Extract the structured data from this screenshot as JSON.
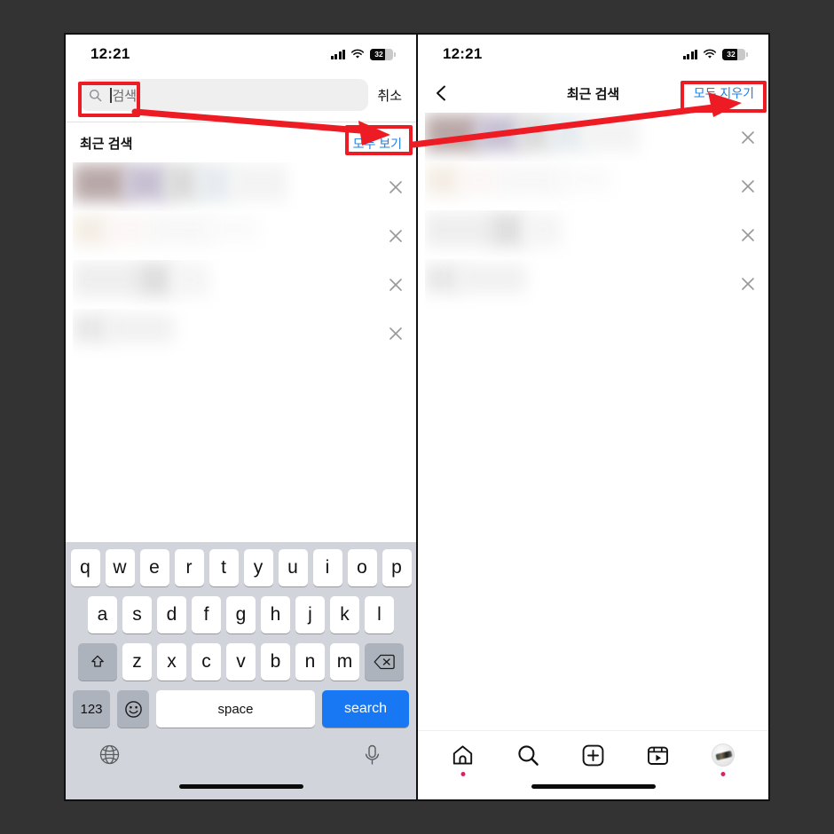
{
  "background_color": "#333333",
  "accent_color": "#1f7fe0",
  "annotation_color": "#ed1c24",
  "left_phone": {
    "status_bar": {
      "time": "12:21",
      "signal_icon": "cellular-signal-icon",
      "wifi_icon": "wifi-icon",
      "battery_icon": "battery-icon",
      "battery_percent": "32"
    },
    "search": {
      "icon": "search-icon",
      "value": "",
      "placeholder": "검색",
      "cancel_label": "취소"
    },
    "section": {
      "title": "최근 검색",
      "see_all_label": "모두 보기"
    },
    "recent_rows": [
      {
        "remove_icon": "close-icon",
        "redacted": true
      },
      {
        "remove_icon": "close-icon",
        "redacted": true
      },
      {
        "remove_icon": "close-icon",
        "redacted": true
      },
      {
        "remove_icon": "close-icon",
        "redacted": true
      }
    ],
    "keyboard": {
      "row1": [
        "q",
        "w",
        "e",
        "r",
        "t",
        "y",
        "u",
        "i",
        "o",
        "p"
      ],
      "row2": [
        "a",
        "s",
        "d",
        "f",
        "g",
        "h",
        "j",
        "k",
        "l"
      ],
      "row3": [
        "z",
        "x",
        "c",
        "v",
        "b",
        "n",
        "m"
      ],
      "shift_icon": "shift-icon",
      "backspace_icon": "backspace-icon",
      "numbers_label": "123",
      "emoji_icon": "emoji-icon",
      "space_label": "space",
      "search_label": "search",
      "globe_icon": "globe-icon",
      "mic_icon": "microphone-icon"
    },
    "home_indicator": "home-indicator"
  },
  "right_phone": {
    "status_bar": {
      "time": "12:21",
      "signal_icon": "cellular-signal-icon",
      "wifi_icon": "wifi-icon",
      "battery_icon": "battery-icon",
      "battery_percent": "32"
    },
    "nav": {
      "back_icon": "chevron-left-icon",
      "title": "최근 검색",
      "clear_all_label": "모두 지우기"
    },
    "recent_rows": [
      {
        "remove_icon": "close-icon",
        "redacted": true
      },
      {
        "remove_icon": "close-icon",
        "redacted": true
      },
      {
        "remove_icon": "close-icon",
        "redacted": true
      },
      {
        "remove_icon": "close-icon",
        "redacted": true
      }
    ],
    "tab_bar": [
      {
        "name": "home-icon",
        "badge": true
      },
      {
        "name": "search-icon",
        "badge": false
      },
      {
        "name": "create-icon",
        "badge": false
      },
      {
        "name": "reels-icon",
        "badge": false
      },
      {
        "name": "profile-avatar",
        "badge": true
      }
    ],
    "home_indicator": "home-indicator"
  },
  "annotations": {
    "box_search_field": "highlight-search-field",
    "box_see_all": "highlight-see-all",
    "box_clear_all": "highlight-clear-all",
    "arrow_1": "arrow-search-to-see-all",
    "arrow_2": "arrow-see-all-to-clear-all"
  }
}
